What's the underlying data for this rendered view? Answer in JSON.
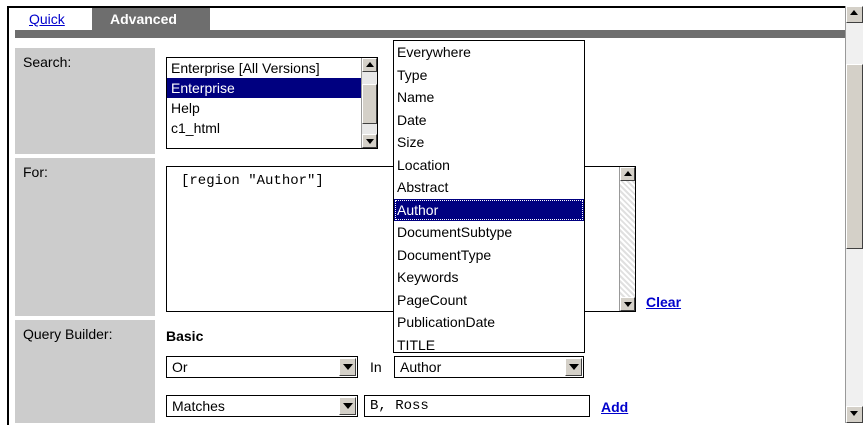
{
  "tabs": {
    "quick": "Quick",
    "advanced": "Advanced"
  },
  "labels": {
    "search": "Search:",
    "for": "For:",
    "query_builder": "Query Builder:"
  },
  "search_list": {
    "items": [
      "Enterprise [All Versions]",
      "Enterprise",
      "Help",
      "c1_html"
    ],
    "selected": "Enterprise"
  },
  "for_text": "[region \"Author\"]",
  "clear_label": "Clear",
  "query_builder": {
    "heading": "Basic",
    "operator": "Or",
    "in_label": "In",
    "field": "Author",
    "match_mode": "Matches",
    "term": "B, Ross",
    "add_label": "Add"
  },
  "field_dropdown": {
    "items": [
      "Everywhere",
      "Type",
      "Name",
      "Date",
      "Size",
      "Location",
      "Abstract",
      "Author",
      "DocumentSubtype",
      "DocumentType",
      "Keywords",
      "PageCount",
      "PublicationDate",
      "TITLE"
    ],
    "selected": "Author"
  },
  "colors": {
    "selection": "#000080",
    "tab_bg": "#6e6e6e",
    "label_bg": "#cccccc",
    "link": "#0000cc"
  }
}
